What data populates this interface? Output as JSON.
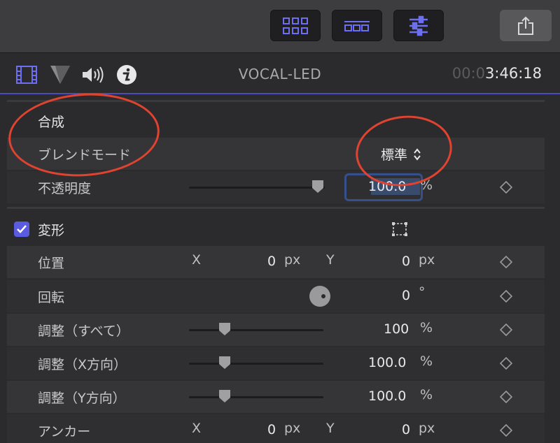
{
  "toolbar": {
    "buttons": [
      "browser-view-icon",
      "timeline-view-icon",
      "inspector-view-icon"
    ],
    "share_icon": "share-icon"
  },
  "header": {
    "icons": [
      "film-icon",
      "color-icon",
      "audio-icon",
      "info-icon"
    ],
    "clip_name": "VOCAL-LED",
    "timecode_dim": "00:0",
    "timecode": "3:46:18"
  },
  "composite": {
    "title": "合成",
    "blend_mode_label": "ブレンドモード",
    "blend_mode_value": "標準",
    "opacity_label": "不透明度",
    "opacity_value": "100.0",
    "opacity_unit": "%"
  },
  "transform": {
    "title": "変形",
    "rows": {
      "position": {
        "label": "位置",
        "x_axis": "X",
        "x": "0",
        "x_unit": "px",
        "y_axis": "Y",
        "y": "0",
        "y_unit": "px"
      },
      "rotation": {
        "label": "回転",
        "value": "0",
        "unit": "°"
      },
      "scale_all": {
        "label": "調整（すべて）",
        "value": "100",
        "unit": "%"
      },
      "scale_x": {
        "label": "調整（X方向）",
        "value": "100.0",
        "unit": "%"
      },
      "scale_y": {
        "label": "調整（Y方向）",
        "value": "100.0",
        "unit": "%"
      },
      "anchor": {
        "label": "アンカー",
        "x_axis": "X",
        "x": "0",
        "x_unit": "px",
        "y_axis": "Y",
        "y": "0",
        "y_unit": "px"
      }
    }
  },
  "colors": {
    "accent": "#5a5be0",
    "highlight_circle": "#e0432f"
  }
}
